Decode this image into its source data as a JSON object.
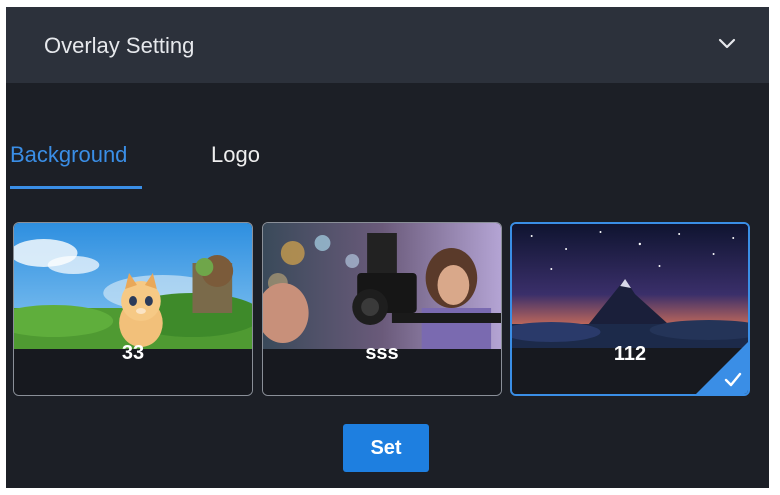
{
  "header": {
    "title": "Overlay Setting",
    "toggle_icon": "chevron-down-icon"
  },
  "tabs": [
    {
      "label": "Background",
      "active": true
    },
    {
      "label": "Logo",
      "active": false
    }
  ],
  "backgrounds": [
    {
      "caption": "33",
      "selected": false
    },
    {
      "caption": "sss",
      "selected": false
    },
    {
      "caption": "112",
      "selected": true
    }
  ],
  "selected_indicator_icon": "checkmark-icon",
  "set_button": {
    "label": "Set"
  },
  "colors": {
    "accent": "#3a8ee6",
    "panel": "#1c1f26",
    "header": "#2c313b",
    "button": "#1e7fe0"
  }
}
